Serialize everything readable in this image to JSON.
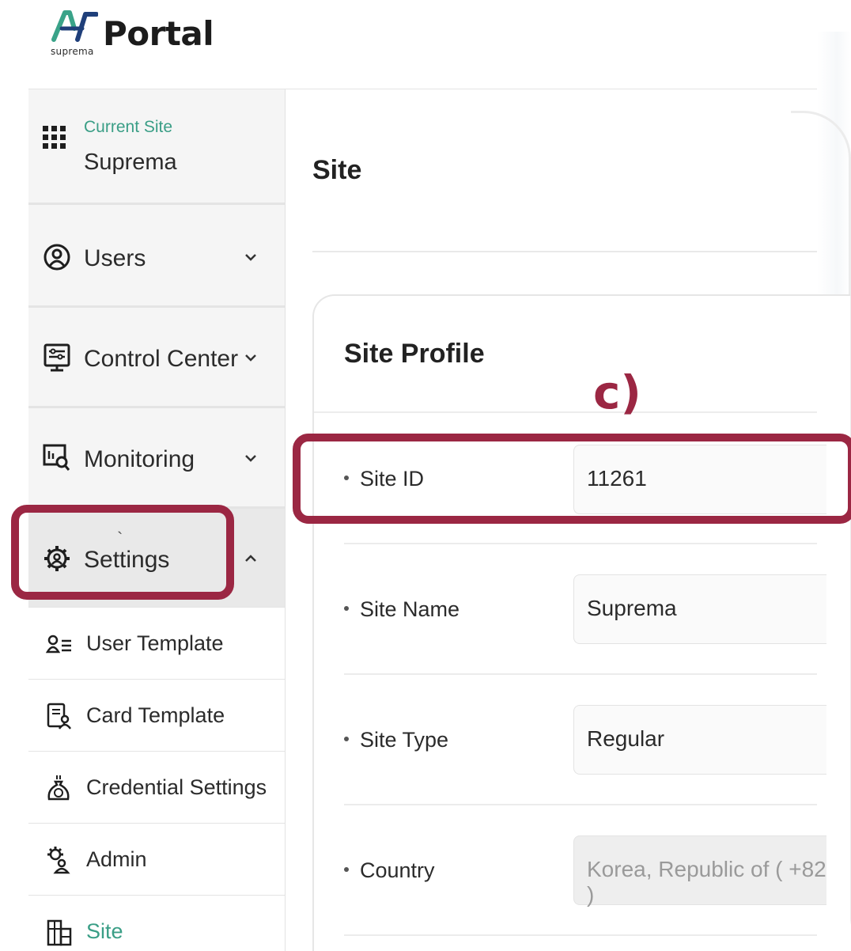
{
  "app": {
    "logo_text": "Portal",
    "logo_sub": "suprema"
  },
  "sidebar": {
    "current_site_label": "Current Site",
    "current_site_name": "Suprema",
    "nav": [
      {
        "label": "Users",
        "icon": "user-circle-icon",
        "expanded": false
      },
      {
        "label": "Control Center",
        "icon": "control-panel-icon",
        "expanded": false
      },
      {
        "label": "Monitoring",
        "icon": "monitor-search-icon",
        "expanded": false
      },
      {
        "label": "Settings",
        "icon": "gear-icon",
        "expanded": true
      }
    ],
    "sub_items": [
      {
        "label": "User Template",
        "icon": "user-list-icon"
      },
      {
        "label": "Card Template",
        "icon": "card-template-icon"
      },
      {
        "label": "Credential Settings",
        "icon": "credential-bag-icon"
      },
      {
        "label": "Admin",
        "icon": "admin-gear-icon"
      },
      {
        "label": "Site",
        "icon": "building-icon",
        "active": true
      }
    ]
  },
  "main": {
    "page_title": "Site",
    "card_title": "Site Profile",
    "fields": [
      {
        "label": "Site ID",
        "value": "11261",
        "disabled": false
      },
      {
        "label": "Site Name",
        "value": "Suprema",
        "disabled": false
      },
      {
        "label": "Site Type",
        "value": "Regular",
        "disabled": false
      },
      {
        "label": "Country",
        "value": "Korea, Republic of ( +82 )",
        "disabled": true
      }
    ]
  },
  "annotation": {
    "label": "c)",
    "highlight_color": "#9b2743"
  },
  "colors": {
    "accent_teal": "#3a9e86",
    "annotation": "#9b2743"
  }
}
